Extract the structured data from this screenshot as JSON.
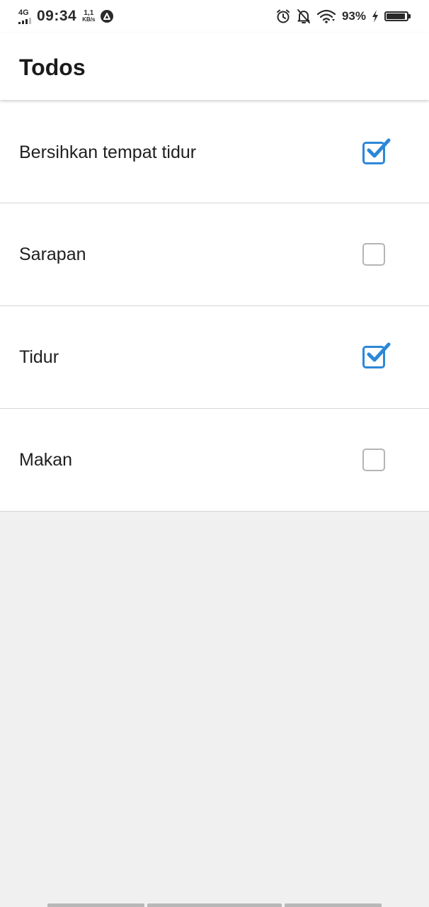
{
  "status_bar": {
    "network": "4G",
    "time": "09:34",
    "speed_value": "1,1",
    "speed_unit": "KB/s",
    "battery_percent": "93%",
    "battery_level": 0.93,
    "icons": [
      "signal-icon",
      "app-notification-icon",
      "alarm-icon",
      "notifications-off-icon",
      "wifi-icon",
      "charging-icon",
      "battery-icon"
    ]
  },
  "app_bar": {
    "title": "Todos"
  },
  "todos": [
    {
      "label": "Bersihkan tempat tidur",
      "done": true
    },
    {
      "label": "Sarapan",
      "done": false
    },
    {
      "label": "Tidur",
      "done": true
    },
    {
      "label": "Makan",
      "done": false
    }
  ],
  "colors": {
    "checkbox_checked": "#2b88d8",
    "checkbox_unchecked": "#b5b5b5",
    "background": "#f0f0f0"
  }
}
